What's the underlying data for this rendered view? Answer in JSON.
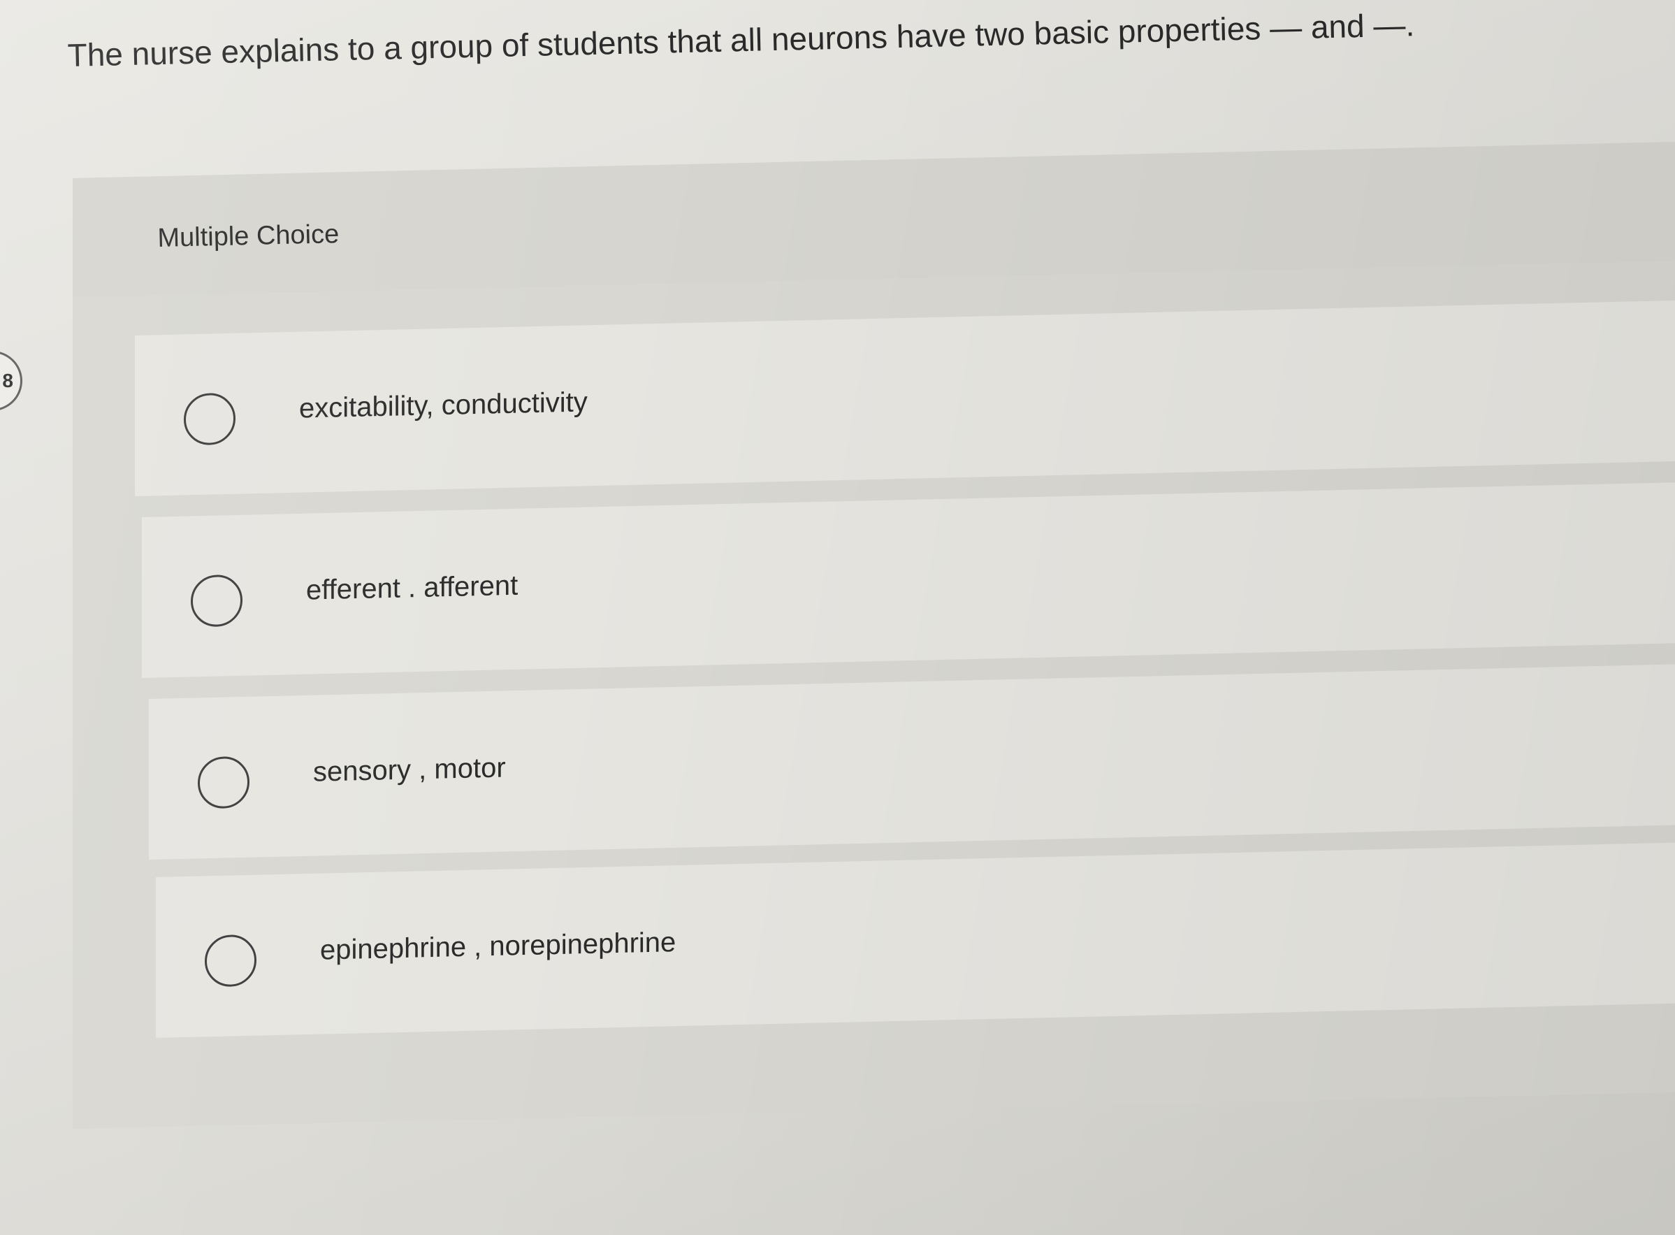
{
  "question": {
    "number": "8",
    "text": "The nurse explains to a group of students that all neurons have two basic properties — and —."
  },
  "question_type": "Multiple Choice",
  "options": [
    {
      "label": "excitability, conductivity"
    },
    {
      "label": "efferent . afferent"
    },
    {
      "label": "sensory , motor"
    },
    {
      "label": "epinephrine , norepinephrine"
    }
  ],
  "icons": {
    "radio": "radio-button-unselected-icon"
  },
  "colors": {
    "background": "#dddcd7",
    "panel": "#d8d7d1",
    "option_bg": "#e6e5e0",
    "text": "#2a2a2a"
  }
}
